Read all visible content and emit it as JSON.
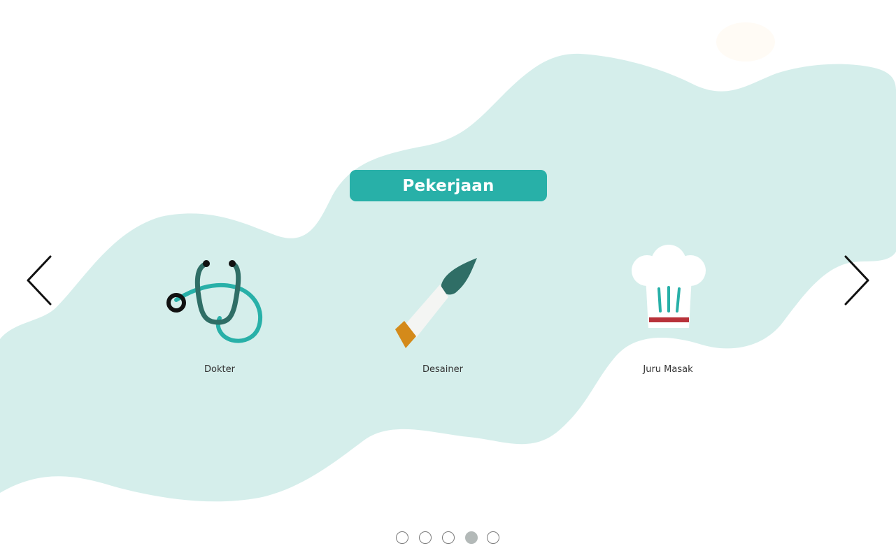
{
  "title": "Pekerjaan",
  "navigation": {
    "prev_icon": "chevron-left-icon",
    "next_icon": "chevron-right-icon"
  },
  "items": [
    {
      "label": "Dokter",
      "icon": "stethoscope-icon"
    },
    {
      "label": "Desainer",
      "icon": "paintbrush-icon"
    },
    {
      "label": "Juru Masak",
      "icon": "chef-hat-icon"
    }
  ],
  "pagination": {
    "count": 5,
    "active_index": 3
  },
  "colors": {
    "background_blob": "#d5eeeb",
    "accent": "#28b0a8",
    "dark_teal": "#2f6e66",
    "orange": "#d48a1a",
    "red": "#b8323a"
  }
}
